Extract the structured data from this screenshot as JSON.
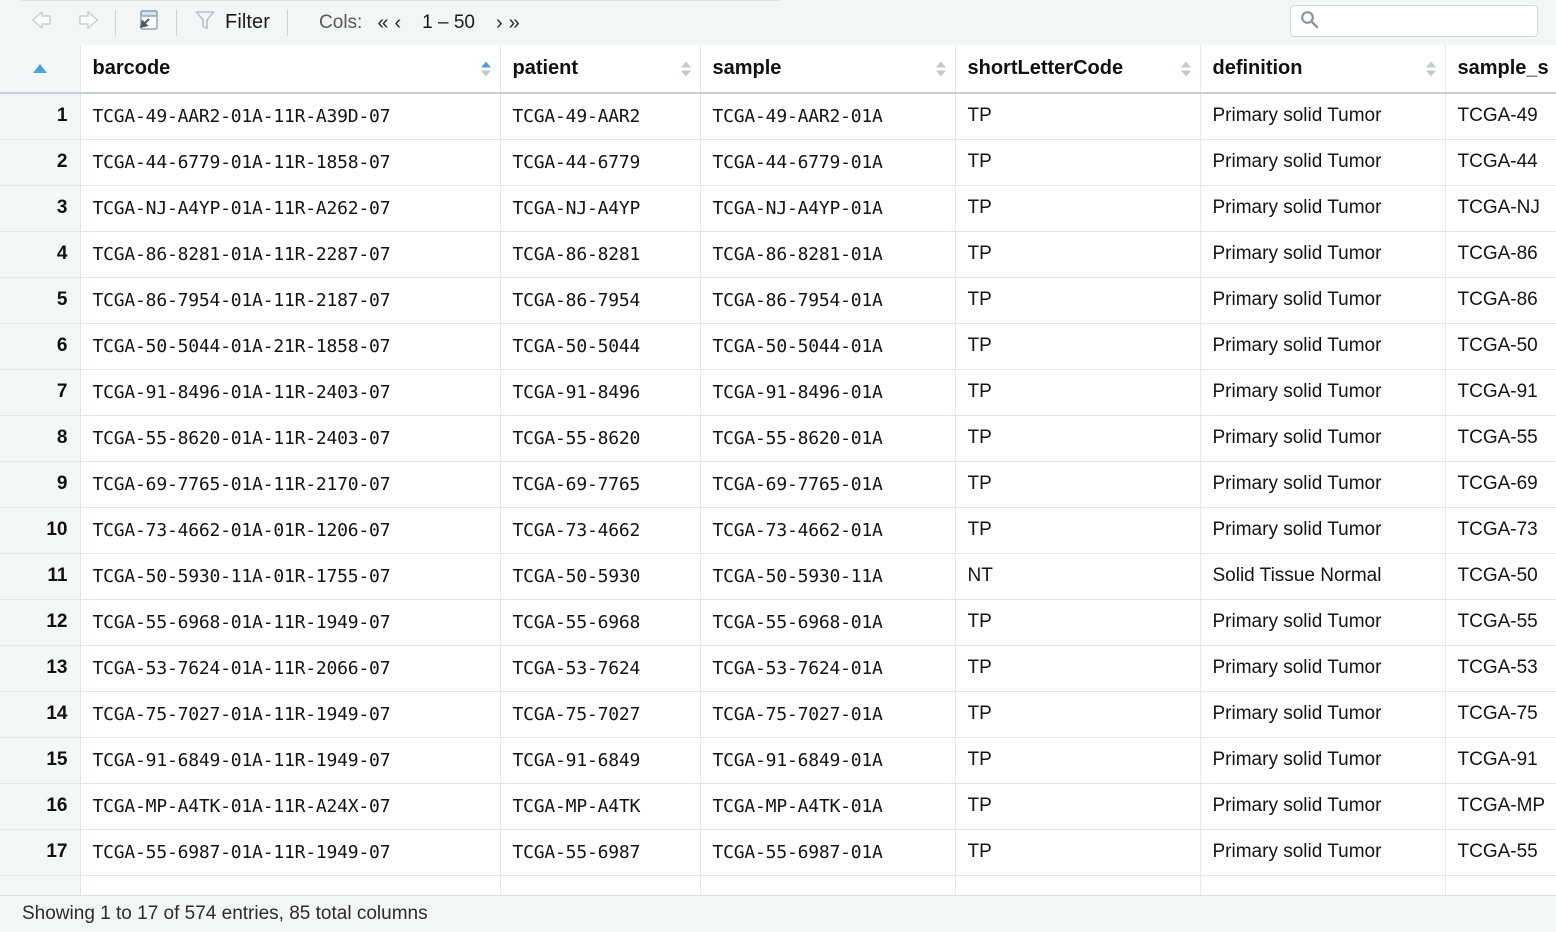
{
  "toolbar": {
    "back_icon": "arrow-left-icon",
    "forward_icon": "arrow-right-icon",
    "popout_icon": "open-in-new-window-icon",
    "filter_icon": "funnel-icon",
    "filter_label": "Filter",
    "cols_label": "Cols:",
    "first_page_label": "«",
    "prev_page_label": "‹",
    "cols_range": "1 – 50",
    "next_page_label": "›",
    "last_page_label": "»",
    "search_icon": "search-icon",
    "search_value": "",
    "search_placeholder": ""
  },
  "table": {
    "sort_column": "barcode",
    "sort_direction": "ascending",
    "columns": [
      {
        "key": "barcode",
        "label": "barcode"
      },
      {
        "key": "patient",
        "label": "patient"
      },
      {
        "key": "sample",
        "label": "sample"
      },
      {
        "key": "shortLetterCode",
        "label": "shortLetterCode"
      },
      {
        "key": "definition",
        "label": "definition"
      },
      {
        "key": "sample_s",
        "label": "sample_s"
      }
    ],
    "rows": [
      {
        "n": "1",
        "barcode": "TCGA-49-AAR2-01A-11R-A39D-07",
        "patient": "TCGA-49-AAR2",
        "sample": "TCGA-49-AAR2-01A",
        "shortLetterCode": "TP",
        "definition": "Primary solid Tumor",
        "sample_s": "TCGA-49"
      },
      {
        "n": "2",
        "barcode": "TCGA-44-6779-01A-11R-1858-07",
        "patient": "TCGA-44-6779",
        "sample": "TCGA-44-6779-01A",
        "shortLetterCode": "TP",
        "definition": "Primary solid Tumor",
        "sample_s": "TCGA-44"
      },
      {
        "n": "3",
        "barcode": "TCGA-NJ-A4YP-01A-11R-A262-07",
        "patient": "TCGA-NJ-A4YP",
        "sample": "TCGA-NJ-A4YP-01A",
        "shortLetterCode": "TP",
        "definition": "Primary solid Tumor",
        "sample_s": "TCGA-NJ"
      },
      {
        "n": "4",
        "barcode": "TCGA-86-8281-01A-11R-2287-07",
        "patient": "TCGA-86-8281",
        "sample": "TCGA-86-8281-01A",
        "shortLetterCode": "TP",
        "definition": "Primary solid Tumor",
        "sample_s": "TCGA-86"
      },
      {
        "n": "5",
        "barcode": "TCGA-86-7954-01A-11R-2187-07",
        "patient": "TCGA-86-7954",
        "sample": "TCGA-86-7954-01A",
        "shortLetterCode": "TP",
        "definition": "Primary solid Tumor",
        "sample_s": "TCGA-86"
      },
      {
        "n": "6",
        "barcode": "TCGA-50-5044-01A-21R-1858-07",
        "patient": "TCGA-50-5044",
        "sample": "TCGA-50-5044-01A",
        "shortLetterCode": "TP",
        "definition": "Primary solid Tumor",
        "sample_s": "TCGA-50"
      },
      {
        "n": "7",
        "barcode": "TCGA-91-8496-01A-11R-2403-07",
        "patient": "TCGA-91-8496",
        "sample": "TCGA-91-8496-01A",
        "shortLetterCode": "TP",
        "definition": "Primary solid Tumor",
        "sample_s": "TCGA-91"
      },
      {
        "n": "8",
        "barcode": "TCGA-55-8620-01A-11R-2403-07",
        "patient": "TCGA-55-8620",
        "sample": "TCGA-55-8620-01A",
        "shortLetterCode": "TP",
        "definition": "Primary solid Tumor",
        "sample_s": "TCGA-55"
      },
      {
        "n": "9",
        "barcode": "TCGA-69-7765-01A-11R-2170-07",
        "patient": "TCGA-69-7765",
        "sample": "TCGA-69-7765-01A",
        "shortLetterCode": "TP",
        "definition": "Primary solid Tumor",
        "sample_s": "TCGA-69"
      },
      {
        "n": "10",
        "barcode": "TCGA-73-4662-01A-01R-1206-07",
        "patient": "TCGA-73-4662",
        "sample": "TCGA-73-4662-01A",
        "shortLetterCode": "TP",
        "definition": "Primary solid Tumor",
        "sample_s": "TCGA-73"
      },
      {
        "n": "11",
        "barcode": "TCGA-50-5930-11A-01R-1755-07",
        "patient": "TCGA-50-5930",
        "sample": "TCGA-50-5930-11A",
        "shortLetterCode": "NT",
        "definition": "Solid Tissue Normal",
        "sample_s": "TCGA-50"
      },
      {
        "n": "12",
        "barcode": "TCGA-55-6968-01A-11R-1949-07",
        "patient": "TCGA-55-6968",
        "sample": "TCGA-55-6968-01A",
        "shortLetterCode": "TP",
        "definition": "Primary solid Tumor",
        "sample_s": "TCGA-55"
      },
      {
        "n": "13",
        "barcode": "TCGA-53-7624-01A-11R-2066-07",
        "patient": "TCGA-53-7624",
        "sample": "TCGA-53-7624-01A",
        "shortLetterCode": "TP",
        "definition": "Primary solid Tumor",
        "sample_s": "TCGA-53"
      },
      {
        "n": "14",
        "barcode": "TCGA-75-7027-01A-11R-1949-07",
        "patient": "TCGA-75-7027",
        "sample": "TCGA-75-7027-01A",
        "shortLetterCode": "TP",
        "definition": "Primary solid Tumor",
        "sample_s": "TCGA-75"
      },
      {
        "n": "15",
        "barcode": "TCGA-91-6849-01A-11R-1949-07",
        "patient": "TCGA-91-6849",
        "sample": "TCGA-91-6849-01A",
        "shortLetterCode": "TP",
        "definition": "Primary solid Tumor",
        "sample_s": "TCGA-91"
      },
      {
        "n": "16",
        "barcode": "TCGA-MP-A4TK-01A-11R-A24X-07",
        "patient": "TCGA-MP-A4TK",
        "sample": "TCGA-MP-A4TK-01A",
        "shortLetterCode": "TP",
        "definition": "Primary solid Tumor",
        "sample_s": "TCGA-MP"
      },
      {
        "n": "17",
        "barcode": "TCGA-55-6987-01A-11R-1949-07",
        "patient": "TCGA-55-6987",
        "sample": "TCGA-55-6987-01A",
        "shortLetterCode": "TP",
        "definition": "Primary solid Tumor",
        "sample_s": "TCGA-55"
      },
      {
        "n": "",
        "barcode": "",
        "patient": "",
        "sample": "",
        "shortLetterCode": "",
        "definition": "",
        "sample_s": ""
      }
    ]
  },
  "footer": {
    "status": "Showing 1 to 17 of 574 entries, 85 total columns"
  },
  "colors": {
    "toolbar_bg": "#f3f6f7",
    "gutter_bg": "#f3f7f8",
    "sort_active": "#4d9fe0",
    "grid_line": "#e2e7ea",
    "header_rule": "#c9cfd3"
  }
}
